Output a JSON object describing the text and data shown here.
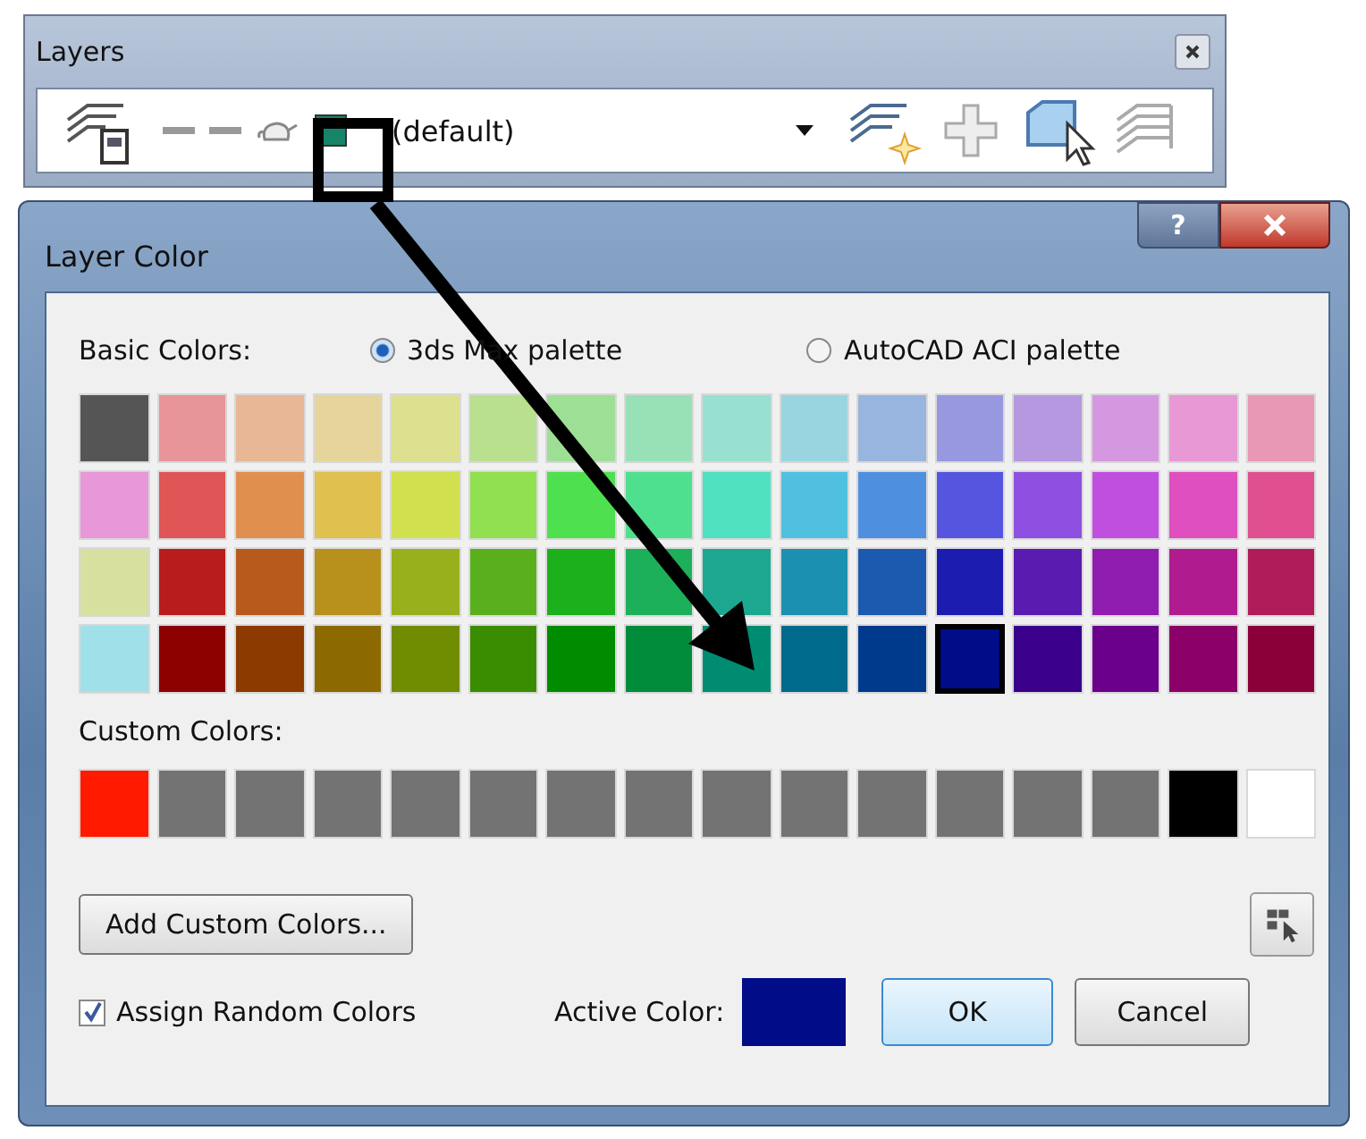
{
  "layers_panel": {
    "title": "Layers",
    "layer_dropdown": {
      "value": "(default)",
      "color": "#17846a"
    }
  },
  "dialog": {
    "title": "Layer Color",
    "help": "?",
    "basic_label": "Basic Colors:",
    "palettes": [
      {
        "label": "3ds Max palette",
        "selected": true
      },
      {
        "label": "AutoCAD ACI palette",
        "selected": false
      }
    ],
    "basic_rows": [
      {
        "swatches": [
          {
            "color": "#555555",
            "selected": false
          },
          {
            "color": "#e8959a",
            "selected": false
          },
          {
            "color": "#e8b795",
            "selected": false
          },
          {
            "color": "#e6d59a",
            "selected": false
          },
          {
            "color": "#dde08f",
            "selected": false
          },
          {
            "color": "#b8e08f",
            "selected": false
          },
          {
            "color": "#9de095",
            "selected": false
          },
          {
            "color": "#98e0b5",
            "selected": false
          },
          {
            "color": "#98e0d0",
            "selected": false
          },
          {
            "color": "#98d5e0",
            "selected": false
          },
          {
            "color": "#98b5e0",
            "selected": false
          },
          {
            "color": "#9898e0",
            "selected": false
          },
          {
            "color": "#b598e0",
            "selected": false
          },
          {
            "color": "#d598e0",
            "selected": false
          },
          {
            "color": "#e898d5",
            "selected": false
          },
          {
            "color": "#e898b5",
            "selected": false
          }
        ]
      },
      {
        "swatches": [
          {
            "color": "#e898d8",
            "selected": false
          },
          {
            "color": "#e05555",
            "selected": false
          },
          {
            "color": "#e08f4f",
            "selected": false
          },
          {
            "color": "#e0c04f",
            "selected": false
          },
          {
            "color": "#d0e04f",
            "selected": false
          },
          {
            "color": "#90e04f",
            "selected": false
          },
          {
            "color": "#4fe04f",
            "selected": false
          },
          {
            "color": "#4fe08f",
            "selected": false
          },
          {
            "color": "#4fe0c0",
            "selected": false
          },
          {
            "color": "#4fc0e0",
            "selected": false
          },
          {
            "color": "#4f8fe0",
            "selected": false
          },
          {
            "color": "#5555e0",
            "selected": false
          },
          {
            "color": "#8f4fe0",
            "selected": false
          },
          {
            "color": "#c04fe0",
            "selected": false
          },
          {
            "color": "#e04fc0",
            "selected": false
          },
          {
            "color": "#e04f8f",
            "selected": false
          }
        ]
      },
      {
        "swatches": [
          {
            "color": "#d8e0a0",
            "selected": false
          },
          {
            "color": "#b81c1c",
            "selected": false
          },
          {
            "color": "#b85a1c",
            "selected": false
          },
          {
            "color": "#b8901c",
            "selected": false
          },
          {
            "color": "#98b01c",
            "selected": false
          },
          {
            "color": "#5ab01c",
            "selected": false
          },
          {
            "color": "#1cb01c",
            "selected": false
          },
          {
            "color": "#1cb05a",
            "selected": false
          },
          {
            "color": "#1ca890",
            "selected": false
          },
          {
            "color": "#1c90b0",
            "selected": false
          },
          {
            "color": "#1c5ab0",
            "selected": false
          },
          {
            "color": "#1c1cb0",
            "selected": false
          },
          {
            "color": "#5a1cb0",
            "selected": false
          },
          {
            "color": "#901cb0",
            "selected": false
          },
          {
            "color": "#b01c90",
            "selected": false
          },
          {
            "color": "#b01c5a",
            "selected": false
          }
        ]
      },
      {
        "swatches": [
          {
            "color": "#a0e0e8",
            "selected": false
          },
          {
            "color": "#8c0000",
            "selected": false
          },
          {
            "color": "#8c3a00",
            "selected": false
          },
          {
            "color": "#8c6a00",
            "selected": false
          },
          {
            "color": "#708c00",
            "selected": false
          },
          {
            "color": "#3a8c00",
            "selected": false
          },
          {
            "color": "#008c00",
            "selected": false
          },
          {
            "color": "#008c3a",
            "selected": false
          },
          {
            "color": "#008c70",
            "selected": false
          },
          {
            "color": "#006a8c",
            "selected": false
          },
          {
            "color": "#003a8c",
            "selected": false
          },
          {
            "color": "#000c88",
            "selected": true
          },
          {
            "color": "#3a008c",
            "selected": false
          },
          {
            "color": "#6a008c",
            "selected": false
          },
          {
            "color": "#8c006a",
            "selected": false
          },
          {
            "color": "#8c003a",
            "selected": false
          }
        ]
      }
    ],
    "custom_label": "Custom Colors:",
    "custom_colors": [
      {
        "color": "#ff1a00"
      },
      {
        "color": "#737373"
      },
      {
        "color": "#737373"
      },
      {
        "color": "#737373"
      },
      {
        "color": "#737373"
      },
      {
        "color": "#737373"
      },
      {
        "color": "#737373"
      },
      {
        "color": "#737373"
      },
      {
        "color": "#737373"
      },
      {
        "color": "#737373"
      },
      {
        "color": "#737373"
      },
      {
        "color": "#737373"
      },
      {
        "color": "#737373"
      },
      {
        "color": "#737373"
      },
      {
        "color": "#000000"
      },
      {
        "color": "#ffffff"
      }
    ],
    "add_button": "Add Custom Colors...",
    "random_colors": {
      "label": "Assign Random Colors",
      "checked": true
    },
    "active_color": {
      "label": "Active Color:",
      "color": "#000c88"
    },
    "buttons": [
      {
        "label": "OK",
        "default": true
      },
      {
        "label": "Cancel",
        "default": false
      }
    ]
  }
}
